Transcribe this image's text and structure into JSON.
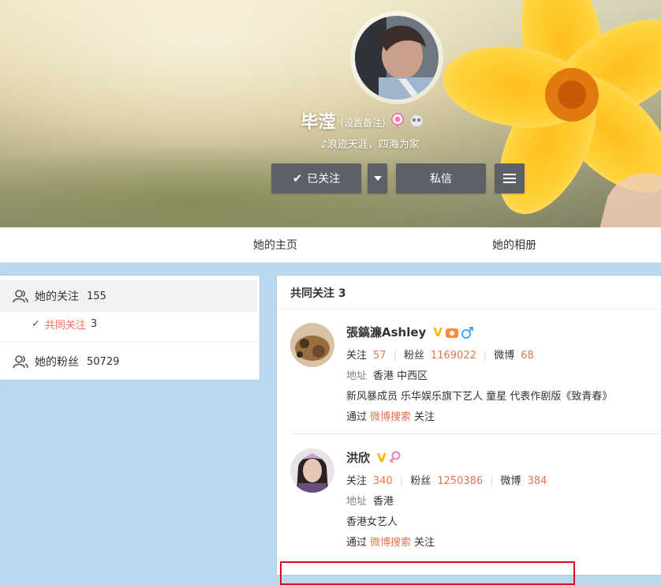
{
  "profile": {
    "name": "毕滢",
    "remark": "(设置备注)",
    "tagline": "浪迹天涯，四海为家",
    "followed_label": "已关注",
    "message_label": "私信"
  },
  "tabs": [
    {
      "label": "她的主页"
    },
    {
      "label": "她的相册"
    }
  ],
  "sidebar": {
    "following_label": "她的关注",
    "following_count": "155",
    "common_label": "共同关注",
    "common_count": "3",
    "fans_label": "她的粉丝",
    "fans_count": "50729"
  },
  "common": {
    "title": "共同关注 3",
    "users": [
      {
        "name": "張鎬濂Ashley",
        "follow_label": "关注",
        "follow": "57",
        "fans_label": "粉丝",
        "fans": "1169022",
        "weibo_label": "微博",
        "weibo": "68",
        "addr_label": "地址",
        "addr": "香港 中西区",
        "bio": "新风暴成员 乐华娱乐旗下艺人 童星 代表作剧版《致青春》",
        "via_prefix": "通过",
        "via": "微博搜索",
        "via_suffix": "关注"
      },
      {
        "name": "洪欣",
        "follow_label": "关注",
        "follow": "340",
        "fans_label": "粉丝",
        "fans": "1250386",
        "weibo_label": "微博",
        "weibo": "384",
        "addr_label": "地址",
        "addr": "香港",
        "bio": "香港女艺人",
        "via_prefix": "通过",
        "via": "微博搜索",
        "via_suffix": "关注"
      }
    ]
  },
  "colors": {
    "accent": "#eb7350",
    "button": "#5e6069",
    "vip": "#ffb400",
    "highlight": "#d6111c"
  }
}
